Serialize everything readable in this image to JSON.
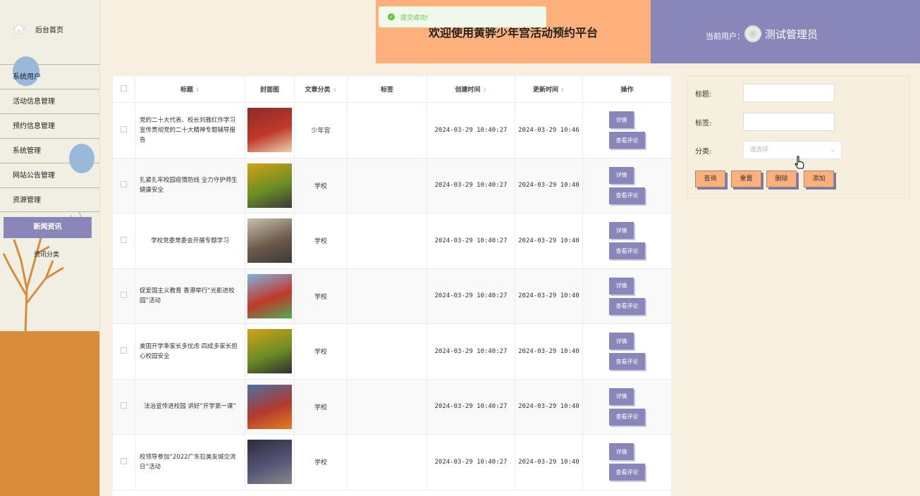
{
  "sidebar": {
    "home_label": "后台首页",
    "items": [
      "系统用户",
      "活动信息管理",
      "预约信息管理",
      "系统管理",
      "网站公告管理",
      "资源管理"
    ],
    "active_label": "新闻资讯",
    "sub_label": "资讯分类"
  },
  "header": {
    "title": "欢迎使用黄骅少年宫活动预约平台",
    "user_label": "当前用户：",
    "user_name": "测试管理员"
  },
  "toast": {
    "message": "提交成功!",
    "color": "#67c23a"
  },
  "table": {
    "headers": [
      "标题",
      "封面图",
      "文章分类",
      "标签",
      "创建时间",
      "更新时间",
      "操作"
    ],
    "rows": [
      {
        "title": "党的二十大代表、校长刘雅红作学习宣传贯彻党的二十大精神专题辅导报告",
        "category": "少年宫",
        "tag": "",
        "created": "2024-03-29 10:40:27",
        "updated": "2024-03-29 10:46"
      },
      {
        "title": "扎紧扎牢校园疫情防线 全力守护师生健康安全",
        "category": "学校",
        "tag": "",
        "created": "2024-03-29 10:40:27",
        "updated": "2024-03-29 10:40"
      },
      {
        "title": "学校党委常委会开展专题学习",
        "category": "学校",
        "tag": "",
        "created": "2024-03-29 10:40:27",
        "updated": "2024-03-29 10:40"
      },
      {
        "title": "促爱国主义教育 香港举行“光影进校园”活动",
        "category": "学校",
        "tag": "",
        "created": "2024-03-29 10:40:27",
        "updated": "2024-03-29 10:40"
      },
      {
        "title": "美国开学季家长多忧虑 四成多家长担心校园安全",
        "category": "学校",
        "tag": "",
        "created": "2024-03-29 10:40:27",
        "updated": "2024-03-29 10:40"
      },
      {
        "title": "法治宣传进校园 讲好“开学第一课”",
        "category": "学校",
        "tag": "",
        "created": "2024-03-29 10:40:27",
        "updated": "2024-03-29 10:40"
      },
      {
        "title": "校领导参加“2022广东拉美友城交流日”活动",
        "category": "学校",
        "tag": "",
        "created": "2024-03-29 10:40:27",
        "updated": "2024-03-29 10:40"
      }
    ],
    "detail_label": "详情",
    "comment_label": "查看评论"
  },
  "search": {
    "title_label": "标题:",
    "tag_label": "标签:",
    "category_label": "分类:",
    "category_placeholder": "请选择",
    "query_label": "查询",
    "reset_label": "重置",
    "delete_label": "删除",
    "add_label": "添加"
  },
  "colors": {
    "accent": "#8987ba",
    "orange": "#fdb07c",
    "cream": "#f7f0e1"
  }
}
